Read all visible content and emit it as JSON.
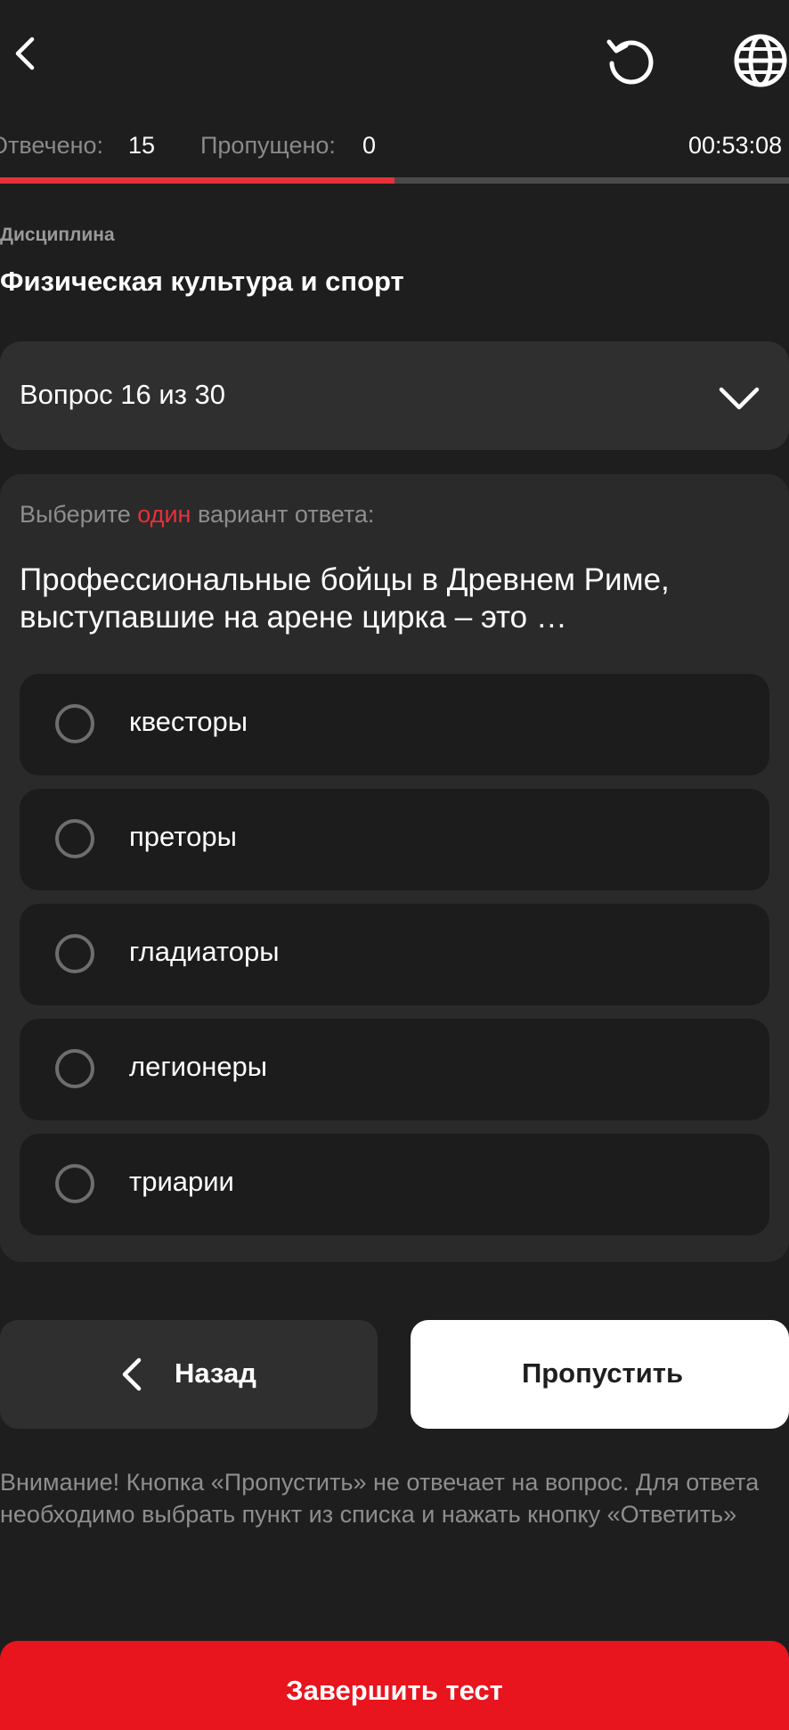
{
  "header": {
    "back_icon": "chevron-left-icon",
    "reset_icon": "rotate-ccw-icon",
    "language_icon": "globe-icon"
  },
  "stats": {
    "answered_label": "Отвечено:",
    "answered_value": "15",
    "skipped_label": "Пропущено:",
    "skipped_value": "0",
    "timer": "00:53:08"
  },
  "progress": {
    "fraction": 0.5,
    "fill_color": "#e8303a"
  },
  "discipline": {
    "label": "Дисциплина",
    "value": "Физическая культура и спорт"
  },
  "question_selector": {
    "label": "Вопрос 16 из 30",
    "icon": "chevron-down-icon"
  },
  "question": {
    "instruction_prefix": "Выберите ",
    "instruction_accent": "один",
    "instruction_suffix": " вариант ответа:",
    "text": "Профессиональные бойцы в Древнем Риме, выступавшие на арене цирка – это …",
    "options": [
      {
        "label": "квесторы"
      },
      {
        "label": "преторы"
      },
      {
        "label": "гладиаторы"
      },
      {
        "label": "легионеры"
      },
      {
        "label": "триарии"
      }
    ]
  },
  "actions": {
    "back_label": "Назад",
    "skip_label": "Пропустить",
    "finish_label": "Завершить тест"
  },
  "notice": "Внимание! Кнопка «Пропустить» не отвечает на вопрос. Для ответа необходимо выбрать пункт из списка и нажать кнопку «Ответить»",
  "colors": {
    "background": "#1e1e1e",
    "accent": "#e8303a",
    "finish": "#e8141e"
  }
}
